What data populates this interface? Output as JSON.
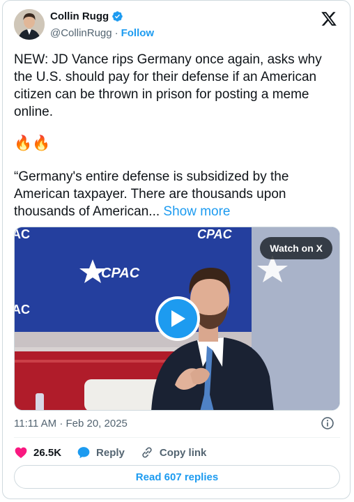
{
  "author": {
    "name": "Collin Rugg",
    "handle": "@CollinRugg",
    "separator": "·",
    "follow_label": "Follow"
  },
  "tweet": {
    "text": "NEW: JD Vance rips Germany once again, asks why the U.S. should pay for their defense if an American citizen can be thrown in prison for posting a meme online.",
    "emoji": "🔥🔥",
    "quote": "“Germany's entire defense is subsidized by the American taxpayer. There are thousands upon thousands of American...",
    "show_more_label": "Show more"
  },
  "media": {
    "watch_label": "Watch on X",
    "backdrop_text": "CPAC",
    "backdrop_fragment": "AC"
  },
  "meta": {
    "timestamp": "11:11 AM · Feb 20, 2025"
  },
  "actions": {
    "likes": "26.5K",
    "reply_label": "Reply",
    "copy_label": "Copy link"
  },
  "footer": {
    "read_replies_label": "Read 607 replies"
  },
  "colors": {
    "accent": "#1d9bf0",
    "like": "#f91880",
    "text_secondary": "#536471"
  }
}
